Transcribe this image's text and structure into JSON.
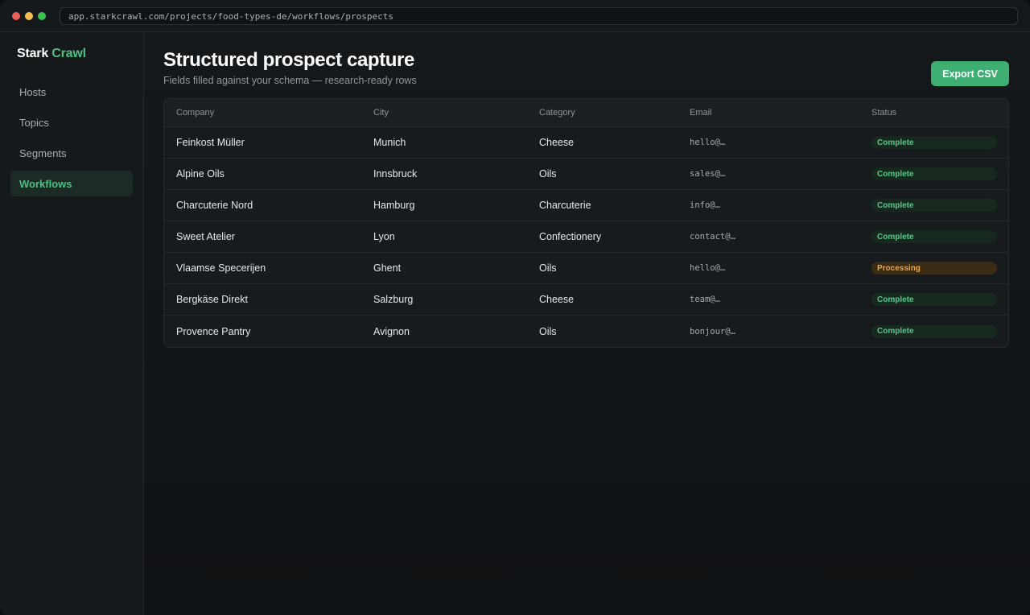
{
  "window": {
    "dots": [
      "#ec5f59",
      "#f4bf4f",
      "#3cc153"
    ],
    "url": "app.starkcrawl.com/projects/food-types-de/workflows/prospects"
  },
  "sidebar": {
    "brand_part1": "Stark",
    "brand_part2": "Crawl",
    "items": [
      {
        "label": "Hosts",
        "active": false
      },
      {
        "label": "Topics",
        "active": false
      },
      {
        "label": "Segments",
        "active": false
      },
      {
        "label": "Workflows",
        "active": true
      }
    ]
  },
  "header": {
    "title": "Structured prospect capture",
    "subtitle": "Fields filled against your schema — research-ready rows",
    "export_label": "Export CSV"
  },
  "table": {
    "columns": [
      "Company",
      "City",
      "Category",
      "Email",
      "Status"
    ],
    "rows": [
      {
        "company": "Feinkost Müller",
        "city": "Munich",
        "category": "Cheese",
        "email": "hello@…",
        "status": "Complete"
      },
      {
        "company": "Alpine Oils",
        "city": "Innsbruck",
        "category": "Oils",
        "email": "sales@…",
        "status": "Complete"
      },
      {
        "company": "Charcuterie Nord",
        "city": "Hamburg",
        "category": "Charcuterie",
        "email": "info@…",
        "status": "Complete"
      },
      {
        "company": "Sweet Atelier",
        "city": "Lyon",
        "category": "Confectionery",
        "email": "contact@…",
        "status": "Complete"
      },
      {
        "company": "Vlaamse Specerijen",
        "city": "Ghent",
        "category": "Oils",
        "email": "hello@…",
        "status": "Processing"
      },
      {
        "company": "Bergkäse Direkt",
        "city": "Salzburg",
        "category": "Cheese",
        "email": "team@…",
        "status": "Complete"
      },
      {
        "company": "Provence Pantry",
        "city": "Avignon",
        "category": "Oils",
        "email": "bonjour@…",
        "status": "Complete"
      }
    ]
  },
  "colors": {
    "accent": "#3fae73",
    "complete": "#55c98a",
    "processing": "#f0a63d"
  }
}
